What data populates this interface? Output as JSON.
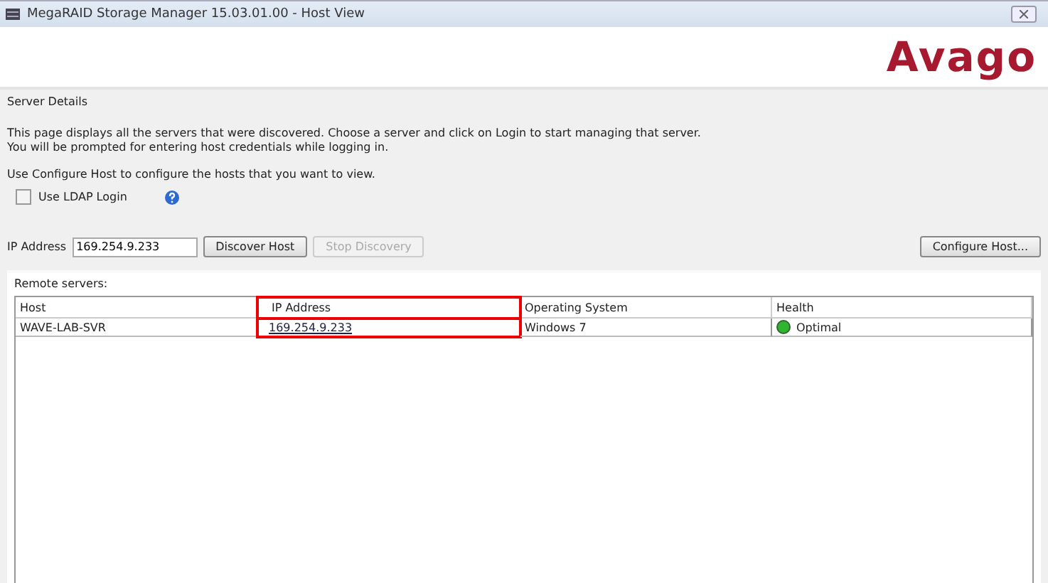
{
  "window": {
    "title": "MegaRAID Storage Manager 15.03.01.00 - Host View"
  },
  "logo": "Avago",
  "section_title": "Server Details",
  "description": [
    "This page displays all the servers that were discovered. Choose a server and click on Login to start managing that server.",
    "You will be prompted for entering host credentials while logging in."
  ],
  "configure_note": "Use Configure Host to configure the hosts that you want to view.",
  "ldap": {
    "label": "Use LDAP Login",
    "checked": false
  },
  "ip_field": {
    "label": "IP Address",
    "value": "169.254.9.233"
  },
  "buttons": [
    {
      "label": "Discover Host",
      "disabled": false
    },
    {
      "label": "Stop Discovery",
      "disabled": true
    }
  ],
  "configure_button": "Configure Host...",
  "remote": {
    "title": "Remote servers:",
    "columns": [
      {
        "label": "Host",
        "highlighted": false
      },
      {
        "label": "IP Address",
        "highlighted": true
      },
      {
        "label": "Operating System",
        "highlighted": false
      },
      {
        "label": "Health",
        "highlighted": false
      }
    ],
    "rows": [
      {
        "host": "WAVE-LAB-SVR",
        "ip": "169.254.9.233",
        "os": "Windows 7",
        "health": "Optimal",
        "color": "#2fb52f"
      }
    ]
  }
}
